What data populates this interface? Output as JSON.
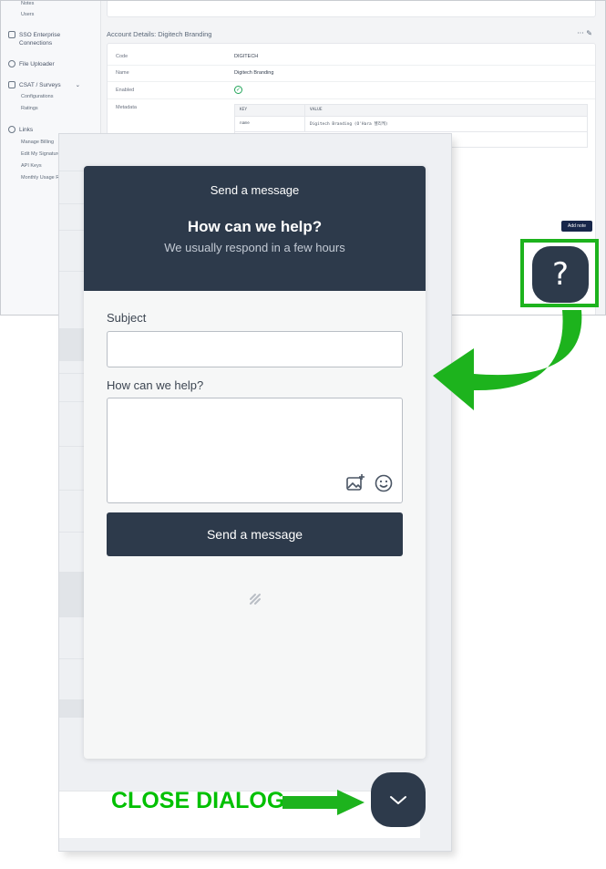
{
  "sidebar": {
    "items": [
      {
        "label": "Notes",
        "kind": "sub"
      },
      {
        "label": "Users",
        "kind": "sub"
      },
      {
        "label": "SSO Enterprise Connections",
        "icon": "sso-icon"
      },
      {
        "label": "File Uploader",
        "icon": "upload-icon"
      },
      {
        "label": "CSAT / Surveys",
        "icon": "survey-icon",
        "expanded": true
      },
      {
        "label": "Configurations",
        "kind": "sub"
      },
      {
        "label": "Ratings",
        "kind": "sub"
      },
      {
        "label": "Links",
        "icon": "link-icon"
      },
      {
        "label": "Manage Billing",
        "kind": "sub"
      },
      {
        "label": "Edit My Signature",
        "kind": "sub"
      },
      {
        "label": "API Keys",
        "kind": "sub"
      },
      {
        "label": "Monthly Usage Report",
        "kind": "sub"
      }
    ]
  },
  "account": {
    "section_title": "Account Details: Digitech Branding",
    "actions": "···  ✎",
    "rows": [
      {
        "label": "Code",
        "value": "DIGITECH"
      },
      {
        "label": "Name",
        "value": "Digitech Branding"
      },
      {
        "label": "Enabled",
        "value": "✓"
      },
      {
        "label": "Metadata",
        "value": ""
      }
    ],
    "metadata_headers": [
      "KEY",
      "VALUE"
    ],
    "metadata_rows": [
      {
        "key": "name",
        "value": "Digitech Branding (O'Hara 헬리케)"
      }
    ],
    "add_note_label": "Add note"
  },
  "widget": {
    "top_title": "Send a message",
    "heading": "How can we help?",
    "subheading": "We usually respond in a few hours",
    "subject_label": "Subject",
    "subject_value": "",
    "message_label": "How can we help?",
    "message_value": "",
    "send_label": "Send a message",
    "launcher_symbol": "?"
  },
  "annotations": {
    "close_dialog": "CLOSE DIALOG",
    "accent_color": "#1db31d"
  },
  "colors": {
    "widget_dark": "#2d3a4b",
    "annotation_green": "#00c000"
  }
}
